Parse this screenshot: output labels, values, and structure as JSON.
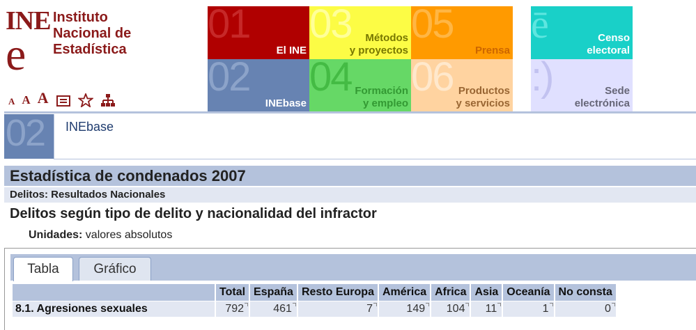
{
  "logo": {
    "mark_top": "INE",
    "mark_bottom": "e",
    "line1": "Instituto",
    "line2": "Nacional de",
    "line3": "Estadística"
  },
  "toolbar": {
    "font_small": "A",
    "font_medium": "A",
    "font_large": "A",
    "icons": [
      "document-icon",
      "star-icon",
      "sitemap-icon"
    ]
  },
  "tiles": [
    {
      "id": "01",
      "label_1": "El INE",
      "label_2": ""
    },
    {
      "id": "03",
      "label_1": "Métodos",
      "label_2": "y proyectos"
    },
    {
      "id": "05",
      "label_1": "Prensa",
      "label_2": ""
    },
    {
      "id": "02",
      "label_1": "INEbase",
      "label_2": ""
    },
    {
      "id": "04",
      "label_1": "Formación",
      "label_2": "y empleo"
    },
    {
      "id": "06",
      "label_1": "Productos",
      "label_2": "y servicios"
    }
  ],
  "censo": {
    "symbol": "ē",
    "label_1": "Censo",
    "label_2": "electoral"
  },
  "sede": {
    "symbol": ":)",
    "label_1": "Sede",
    "label_2": "electrónica"
  },
  "section": {
    "number": "02",
    "title": "INEbase"
  },
  "page": {
    "title": "Estadística de condenados 2007",
    "subtitle": "Delitos: Resultados Nacionales",
    "table_title": "Delitos según tipo de delito y nacionalidad del infractor",
    "units_label": "Unidades:",
    "units_value": "valores absolutos"
  },
  "tabs": {
    "tabla": "Tabla",
    "grafico": "Gráfico"
  },
  "table": {
    "columns": [
      "Total",
      "España",
      "Resto Europa",
      "América",
      "Africa",
      "Asia",
      "Oceanía",
      "No consta"
    ],
    "rows": [
      {
        "label": "8.1. Agresiones sexuales",
        "values": [
          "792",
          "461",
          "7",
          "149",
          "104",
          "11",
          "1",
          "0"
        ]
      }
    ]
  },
  "colors": {
    "brand": "#8b1a1a",
    "header_blue": "#b4c2dc",
    "row_blue": "#e2e7f2"
  }
}
